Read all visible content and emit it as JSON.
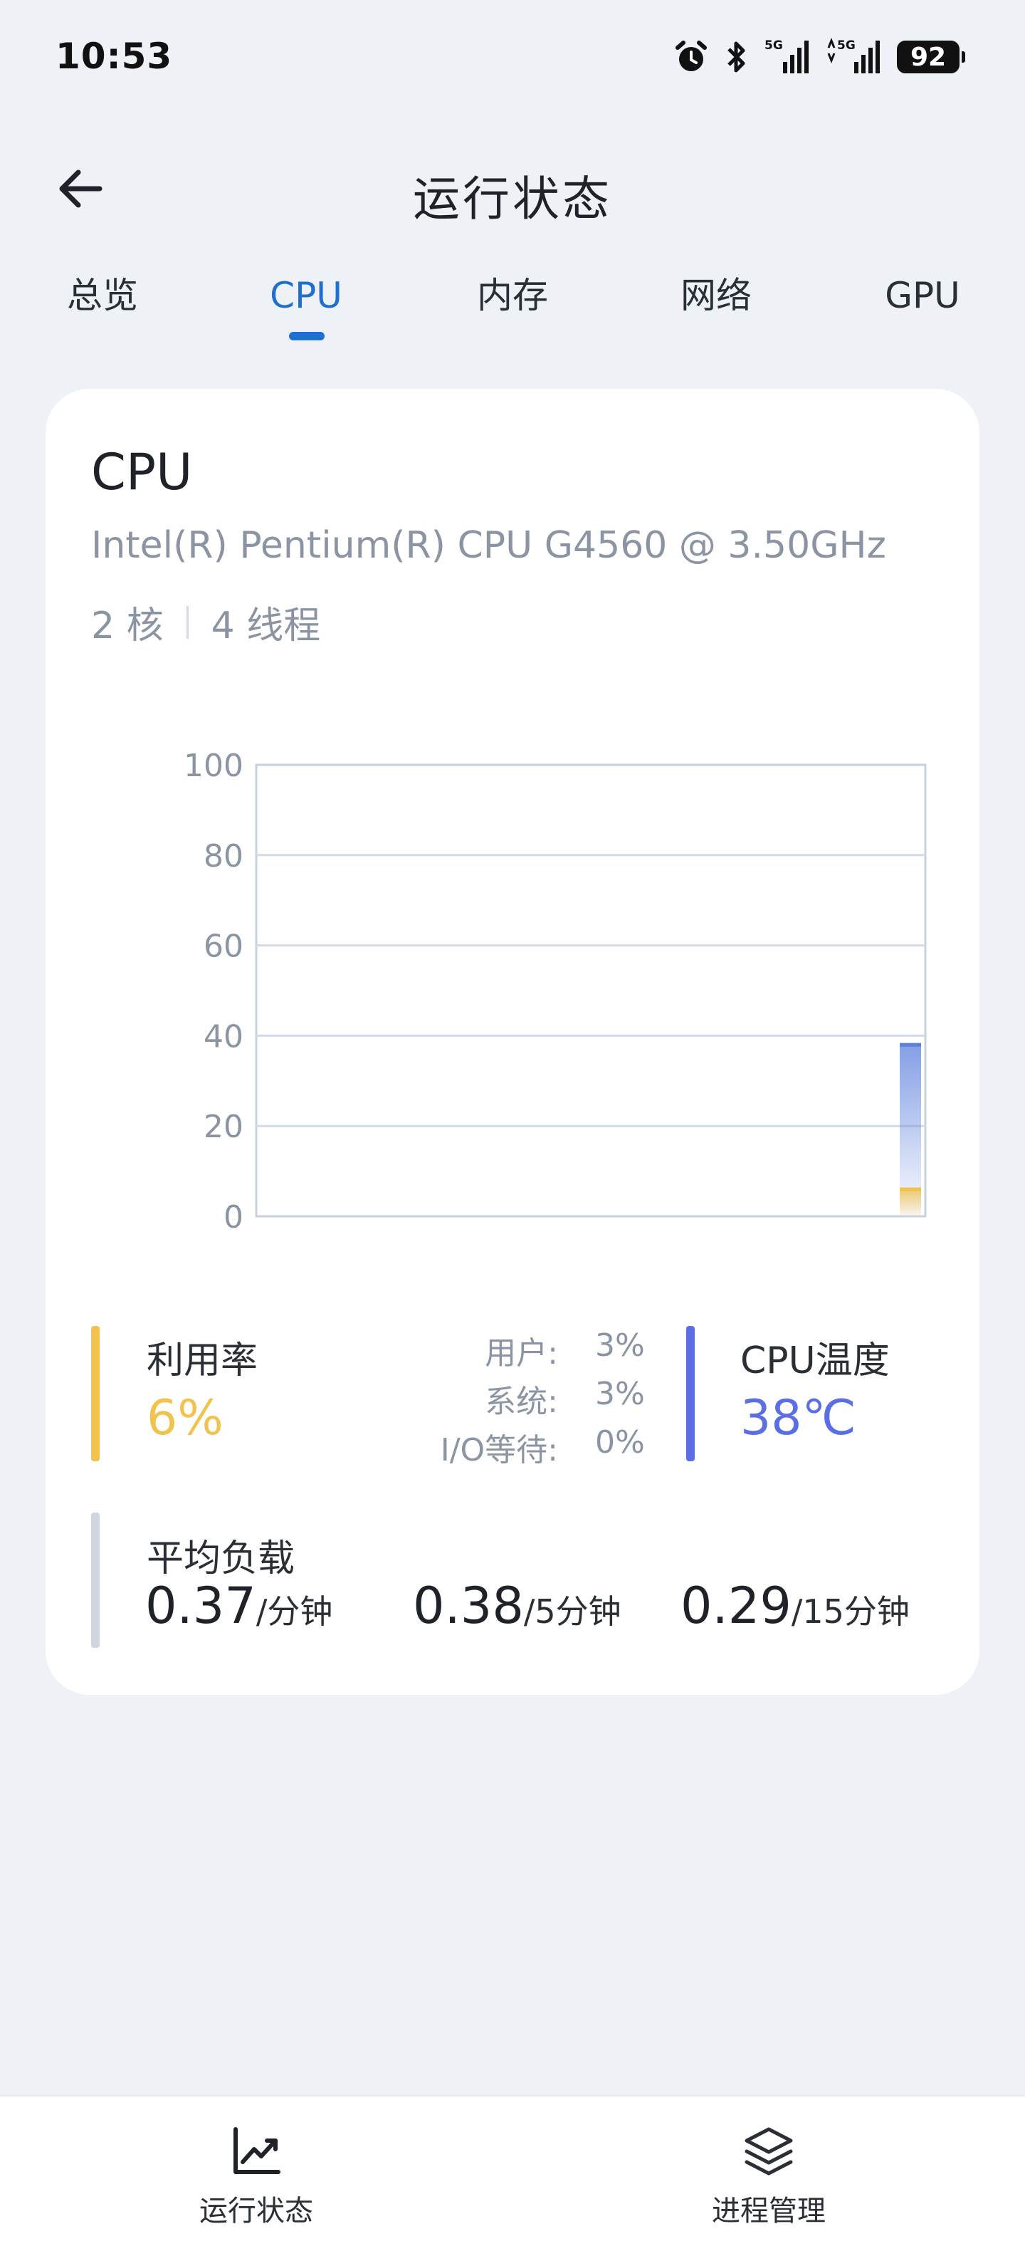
{
  "status_bar": {
    "time": "10:53",
    "battery": "92",
    "icons": [
      "alarm-icon",
      "bluetooth-icon",
      "signal-5g-icon",
      "signal-5g-icon"
    ]
  },
  "header": {
    "back_icon": "arrow-left-icon",
    "title": "运行状态"
  },
  "tabs": {
    "items": [
      {
        "label": "总览"
      },
      {
        "label": "CPU"
      },
      {
        "label": "内存"
      },
      {
        "label": "网络"
      },
      {
        "label": "GPU"
      }
    ],
    "active_index": 1
  },
  "cpu": {
    "title": "CPU",
    "model": "Intel(R) Pentium(R) CPU G4560 @ 3.50GHz",
    "cores": "2 核",
    "threads": "4 线程"
  },
  "chart_data": {
    "type": "area",
    "title": "",
    "xlabel": "",
    "ylabel": "",
    "ylim": [
      0,
      100
    ],
    "yticks": [
      "100",
      "80",
      "60",
      "40",
      "20",
      "0"
    ],
    "grid": true,
    "series": [
      {
        "values": [
          38
        ],
        "color": "#5b7fdc"
      },
      {
        "values": [
          6
        ],
        "color": "#f1c24e"
      }
    ]
  },
  "usage": {
    "label": "利用率",
    "value": "6%",
    "details": [
      {
        "key": "用户:",
        "value": "3%"
      },
      {
        "key": "系统:",
        "value": "3%"
      },
      {
        "key": "I/O等待:",
        "value": "0%"
      }
    ]
  },
  "temperature": {
    "label": "CPU温度",
    "value": "38℃"
  },
  "load": {
    "label": "平均负载",
    "items": [
      {
        "value": "0.37",
        "unit": "/分钟"
      },
      {
        "value": "0.38",
        "unit": "/5分钟"
      },
      {
        "value": "0.29",
        "unit": "/15分钟"
      }
    ]
  },
  "bottom_nav": {
    "items": [
      {
        "label": "运行状态",
        "icon": "line-chart-icon"
      },
      {
        "label": "进程管理",
        "icon": "layers-icon"
      }
    ]
  },
  "colors": {
    "accent": "#1f6fd1",
    "usage": "#f1c24e",
    "temperature": "#5c6ee6",
    "load": "#cfd6df"
  }
}
